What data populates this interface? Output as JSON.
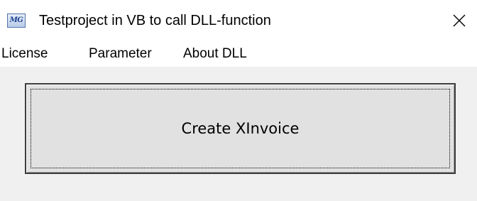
{
  "window": {
    "title": "Testproject in VB to call DLL-function",
    "icon": "MG",
    "icon_name": "app-logo-icon",
    "close_icon": "close-icon"
  },
  "menu": {
    "items": [
      {
        "label": "License"
      },
      {
        "label": "Parameter"
      },
      {
        "label": "About DLL"
      }
    ]
  },
  "main": {
    "button_label": "Create XInvoice"
  },
  "colors": {
    "background": "#f0f0f0",
    "titlebar": "#ffffff",
    "button_face": "#e1e1e1",
    "button_border": "#3c3c3c"
  }
}
